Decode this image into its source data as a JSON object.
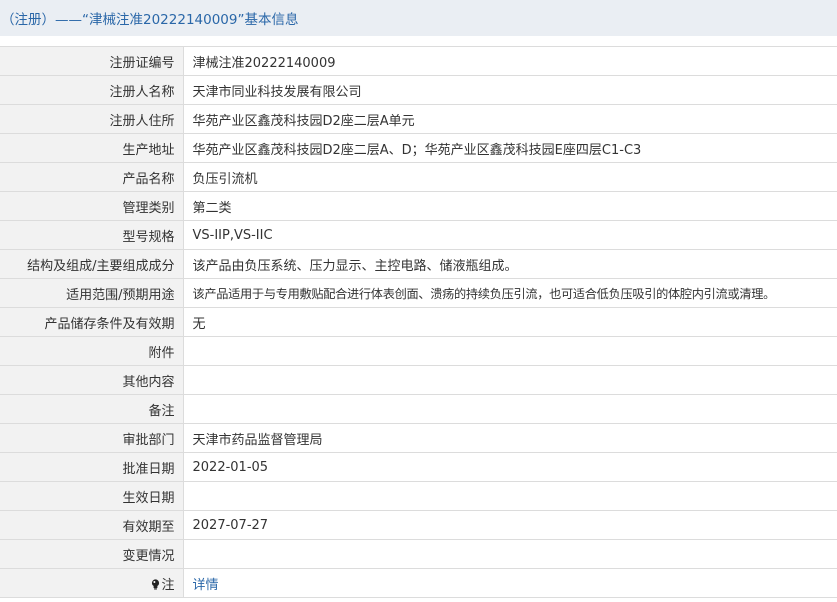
{
  "header": {
    "title": "（注册）——“津械注准20222140009”基本信息"
  },
  "rows": [
    {
      "label": "注册证编号",
      "value": "津械注准20222140009"
    },
    {
      "label": "注册人名称",
      "value": "天津市同业科技发展有限公司"
    },
    {
      "label": "注册人住所",
      "value": "华苑产业区鑫茂科技园D2座二层A单元"
    },
    {
      "label": "生产地址",
      "value": "华苑产业区鑫茂科技园D2座二层A、D；华苑产业区鑫茂科技园E座四层C1-C3"
    },
    {
      "label": "产品名称",
      "value": "负压引流机"
    },
    {
      "label": "管理类别",
      "value": "第二类"
    },
    {
      "label": "型号规格",
      "value": "VS-IIP,VS-IIC"
    },
    {
      "label": "结构及组成/主要组成成分",
      "value": "该产品由负压系统、压力显示、主控电路、储液瓶组成。"
    },
    {
      "label": "适用范围/预期用途",
      "value": "该产品适用于与专用敷贴配合进行体表创面、溃疡的持续负压引流，也可适合低负压吸引的体腔内引流或清理。"
    },
    {
      "label": "产品储存条件及有效期",
      "value": "无"
    },
    {
      "label": "附件",
      "value": ""
    },
    {
      "label": "其他内容",
      "value": ""
    },
    {
      "label": "备注",
      "value": ""
    },
    {
      "label": "审批部门",
      "value": "天津市药品监督管理局"
    },
    {
      "label": "批准日期",
      "value": "2022-01-05"
    },
    {
      "label": "生效日期",
      "value": ""
    },
    {
      "label": "有效期至",
      "value": "2027-07-27"
    },
    {
      "label": "变更情况",
      "value": ""
    }
  ],
  "note_row": {
    "label": "注",
    "icon": "lightbulb-icon",
    "link_text": "详情"
  }
}
